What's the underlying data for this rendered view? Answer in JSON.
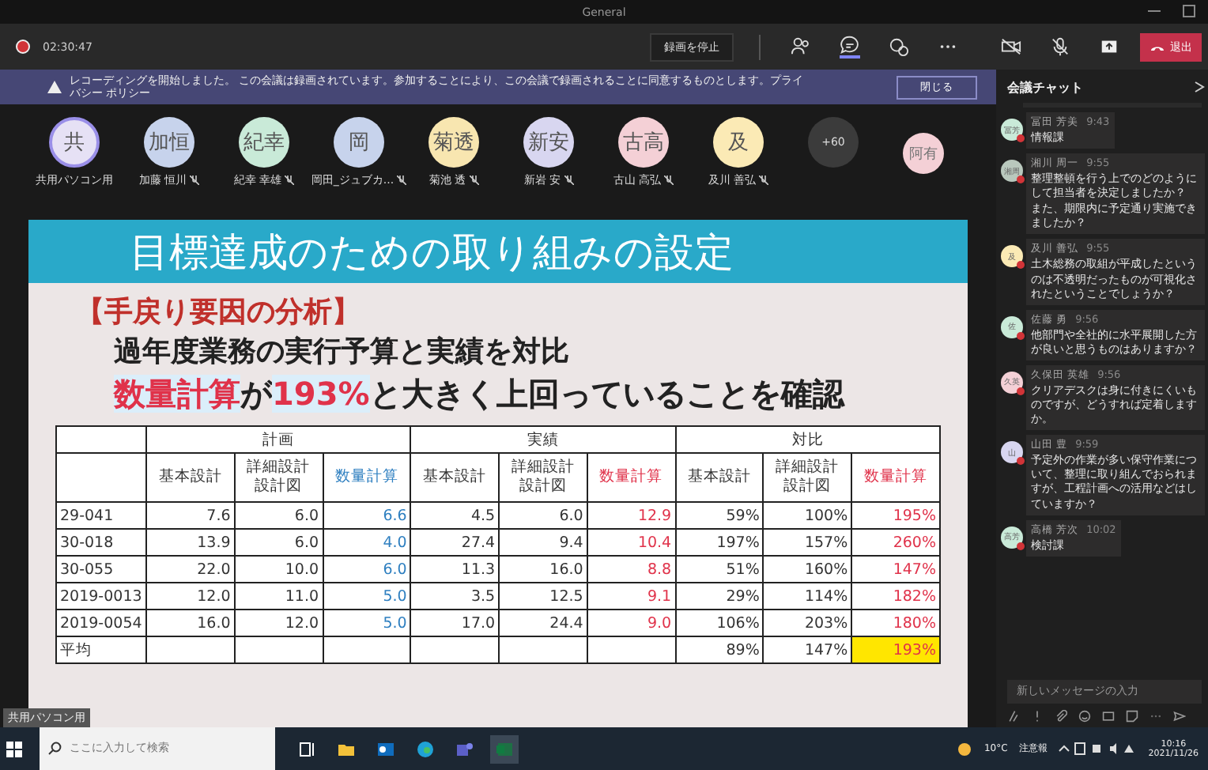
{
  "window": {
    "title": "General"
  },
  "toolbar": {
    "recording_time": "02:30:47",
    "action_button": "録画を停止",
    "leave_button": "退出"
  },
  "banner": {
    "text": "レコーディングを開始しました。 この会議は録画されています。参加することにより、この会議で録画されることに同意するものとします。プライバシー ポリシー",
    "close_button": "閉じる"
  },
  "participants": [
    {
      "initials": "共",
      "name": "共用パソコン用",
      "color": "#e6e1f5",
      "active": true,
      "muted": false
    },
    {
      "initials": "加恒",
      "name": "加藤 恒川",
      "color": "#c7d3ec",
      "active": false,
      "muted": true
    },
    {
      "initials": "紀幸",
      "name": "紀幸 幸雄",
      "color": "#c9ead8",
      "active": false,
      "muted": true
    },
    {
      "initials": "岡",
      "name": "岡田_ジュブカ...",
      "color": "#c7d3ec",
      "active": false,
      "muted": true
    },
    {
      "initials": "菊透",
      "name": "菊池 透",
      "color": "#f8e6b0",
      "active": false,
      "muted": true
    },
    {
      "initials": "新安",
      "name": "新岩 安",
      "color": "#d8d6f0",
      "active": false,
      "muted": true
    },
    {
      "initials": "古高",
      "name": "古山 高弘",
      "color": "#f4d0d6",
      "active": false,
      "muted": true
    },
    {
      "initials": "及",
      "name": "及川 善弘",
      "color": "#fbeab5",
      "active": false,
      "muted": true
    }
  ],
  "more_participants": "+60",
  "side_participant": {
    "initials": "阿有",
    "color": "#f4d0d6"
  },
  "slide": {
    "title": "目標達成のための取り組みの設定",
    "heading": "【手戻り要因の分析】",
    "line": "過年度業務の実行予算と実績を対比",
    "statement": [
      {
        "text": "数量計算",
        "emphasis": true
      },
      {
        "text": "が",
        "emphasis": false
      },
      {
        "text": "193%",
        "emphasis": true
      },
      {
        "text": "と大きく上回っていることを確認",
        "emphasis": false
      }
    ],
    "table": {
      "groups": [
        {
          "label": "計画",
          "columns": [
            {
              "lines": [
                "基本設計"
              ],
              "color": "#333333"
            },
            {
              "lines": [
                "詳細設計",
                "設計図"
              ],
              "color": "#333333"
            },
            {
              "lines": [
                "数量計算"
              ],
              "color": "#2e7fc0"
            }
          ]
        },
        {
          "label": "実績",
          "columns": [
            {
              "lines": [
                "基本設計"
              ],
              "color": "#333333"
            },
            {
              "lines": [
                "詳細設計",
                "設計図"
              ],
              "color": "#333333"
            },
            {
              "lines": [
                "数量計算"
              ],
              "color": "#e0324a"
            }
          ]
        },
        {
          "label": "対比",
          "columns": [
            {
              "lines": [
                "基本設計"
              ],
              "color": "#333333"
            },
            {
              "lines": [
                "詳細設計",
                "設計図"
              ],
              "color": "#333333"
            },
            {
              "lines": [
                "数量計算"
              ],
              "color": "#e0324a"
            }
          ]
        }
      ],
      "rows": [
        {
          "label": "29-041",
          "cells": [
            "7.6",
            "6.0",
            "6.6",
            "4.5",
            "6.0",
            "12.9",
            "59%",
            "100%",
            "195%"
          ]
        },
        {
          "label": "30-018",
          "cells": [
            "13.9",
            "6.0",
            "4.0",
            "27.4",
            "9.4",
            "10.4",
            "197%",
            "157%",
            "260%"
          ]
        },
        {
          "label": "30-055",
          "cells": [
            "22.0",
            "10.0",
            "6.0",
            "11.3",
            "16.0",
            "8.8",
            "51%",
            "160%",
            "147%"
          ]
        },
        {
          "label": "2019-0013",
          "cells": [
            "12.0",
            "11.0",
            "5.0",
            "3.5",
            "12.5",
            "9.1",
            "29%",
            "114%",
            "182%"
          ]
        },
        {
          "label": "2019-0054",
          "cells": [
            "16.0",
            "12.0",
            "5.0",
            "17.0",
            "24.4",
            "9.0",
            "106%",
            "203%",
            "180%"
          ]
        }
      ],
      "summary": {
        "label": "平均",
        "cells": [
          null,
          null,
          null,
          null,
          null,
          null,
          "89%",
          "147%",
          "193%"
        ],
        "last_highlighted": true
      }
    }
  },
  "presenter_label": "共用パソコン用",
  "chat": {
    "title": "会議チャット",
    "messages": [
      {
        "initials": "冨芳",
        "color": "#c9ead8",
        "author": "冨田 芳美",
        "time": "9:43",
        "text": "情報課"
      },
      {
        "initials": "湘周",
        "color": "#b9c8bd",
        "author": "湘川 周一",
        "time": "9:55",
        "text": "整理整頓を行う上でのどのようにして担当者を決定しましたか？",
        "text_2": "また、期限内に予定通り実施できましたか？"
      },
      {
        "initials": "及",
        "color": "#fbeab5",
        "author": "及川 善弘",
        "time": "9:55",
        "text": "土木総務の取組が平成したというのは不透明だったものが可視化されたということでしょうか？"
      },
      {
        "initials": "佐",
        "color": "#c9ead8",
        "author": "佐藤 勇",
        "time": "9:56",
        "text": "他部門や全社的に水平展開した方が良いと思うものはありますか？"
      },
      {
        "initials": "久英",
        "color": "#f4d0d6",
        "author": "久保田 英雄",
        "time": "9:56",
        "text": "クリアデスクは身に付きにくいものですが、どうすれば定着しますか。"
      },
      {
        "initials": "山",
        "color": "#d8d6f0",
        "author": "山田 豊",
        "time": "9:59",
        "text": "予定外の作業が多い保守作業について、整理に取り組んでおられますが、工程計画への活用などはしていますか？"
      },
      {
        "initials": "高芳",
        "color": "#c9ead8",
        "author": "高橋 芳次",
        "time": "10:02",
        "text": "検討課"
      }
    ],
    "input": {
      "placeholder": "新しいメッセージの入力"
    }
  },
  "taskbar": {
    "search": {
      "placeholder": "ここに入力して検索"
    },
    "weather": "10°C",
    "alert": "注意報",
    "time": "10:16",
    "date": "2021/11/26"
  }
}
